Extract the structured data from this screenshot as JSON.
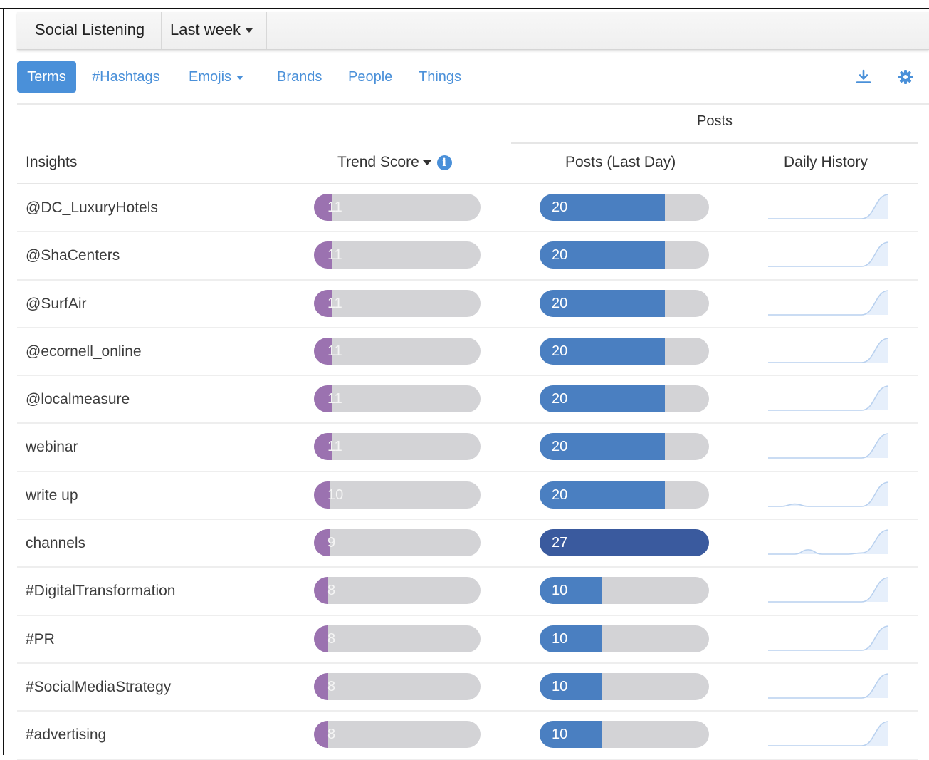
{
  "topbar": {
    "app_title": "Social Listening",
    "period": "Last week"
  },
  "tabs": [
    {
      "label": "Terms"
    },
    {
      "label": "#Hashtags"
    },
    {
      "label": "Emojis"
    },
    {
      "label": "Brands"
    },
    {
      "label": "People"
    },
    {
      "label": "Things"
    }
  ],
  "toolbar_icons": [
    "download-icon",
    "gear-icon"
  ],
  "header": {
    "posts_group": "Posts",
    "insights": "Insights",
    "trend_score": "Trend Score",
    "posts_last_day": "Posts (Last Day)",
    "daily_history": "Daily History"
  },
  "colors": {
    "accent": "#4a90d9",
    "trend_fill": "#9b72b0",
    "posts_fill": "#4a7fc1",
    "posts_fill_max": "#3a5a9e",
    "bar_track": "#d3d3d6"
  },
  "rows": [
    {
      "insight": "@DC_LuxuryHotels",
      "trend_score": "11",
      "trend_fraction": 0.11,
      "posts": "20",
      "posts_fraction": 0.74,
      "history": [
        0,
        0,
        0,
        0,
        0,
        0,
        0,
        0,
        1
      ]
    },
    {
      "insight": "@ShaCenters",
      "trend_score": "11",
      "trend_fraction": 0.11,
      "posts": "20",
      "posts_fraction": 0.74,
      "history": [
        0,
        0,
        0,
        0,
        0,
        0,
        0,
        0,
        1
      ]
    },
    {
      "insight": "@SurfAir",
      "trend_score": "11",
      "trend_fraction": 0.11,
      "posts": "20",
      "posts_fraction": 0.74,
      "history": [
        0,
        0,
        0,
        0,
        0,
        0,
        0,
        0,
        1
      ]
    },
    {
      "insight": "@ecornell_online",
      "trend_score": "11",
      "trend_fraction": 0.11,
      "posts": "20",
      "posts_fraction": 0.74,
      "history": [
        0,
        0,
        0,
        0,
        0,
        0,
        0,
        0,
        1
      ]
    },
    {
      "insight": "@localmeasure",
      "trend_score": "11",
      "trend_fraction": 0.11,
      "posts": "20",
      "posts_fraction": 0.74,
      "history": [
        0,
        0,
        0,
        0,
        0,
        0,
        0,
        0,
        1
      ]
    },
    {
      "insight": "webinar",
      "trend_score": "11",
      "trend_fraction": 0.11,
      "posts": "20",
      "posts_fraction": 0.74,
      "history": [
        0,
        0,
        0,
        0,
        0,
        0,
        0,
        0,
        1
      ]
    },
    {
      "insight": "write up",
      "trend_score": "10",
      "trend_fraction": 0.1,
      "posts": "20",
      "posts_fraction": 0.74,
      "history": [
        0,
        0,
        0.1,
        0,
        0,
        0,
        0,
        0,
        1
      ]
    },
    {
      "insight": "channels",
      "trend_score": "9",
      "trend_fraction": 0.09,
      "posts": "27",
      "posts_fraction": 1.0,
      "history": [
        0,
        0,
        0,
        0.18,
        0,
        0,
        0,
        0.05,
        1
      ]
    },
    {
      "insight": "#DigitalTransformation",
      "trend_score": "8",
      "trend_fraction": 0.08,
      "posts": "10",
      "posts_fraction": 0.37,
      "history": [
        0,
        0,
        0,
        0,
        0,
        0,
        0,
        0,
        1
      ]
    },
    {
      "insight": "#PR",
      "trend_score": "8",
      "trend_fraction": 0.08,
      "posts": "10",
      "posts_fraction": 0.37,
      "history": [
        0,
        0,
        0,
        0,
        0,
        0,
        0,
        0,
        1
      ]
    },
    {
      "insight": "#SocialMediaStrategy",
      "trend_score": "8",
      "trend_fraction": 0.08,
      "posts": "10",
      "posts_fraction": 0.37,
      "history": [
        0,
        0,
        0,
        0,
        0,
        0,
        0,
        0,
        1
      ]
    },
    {
      "insight": "#advertising",
      "trend_score": "8",
      "trend_fraction": 0.08,
      "posts": "10",
      "posts_fraction": 0.37,
      "history": [
        0,
        0,
        0,
        0,
        0,
        0,
        0,
        0,
        1
      ]
    }
  ]
}
